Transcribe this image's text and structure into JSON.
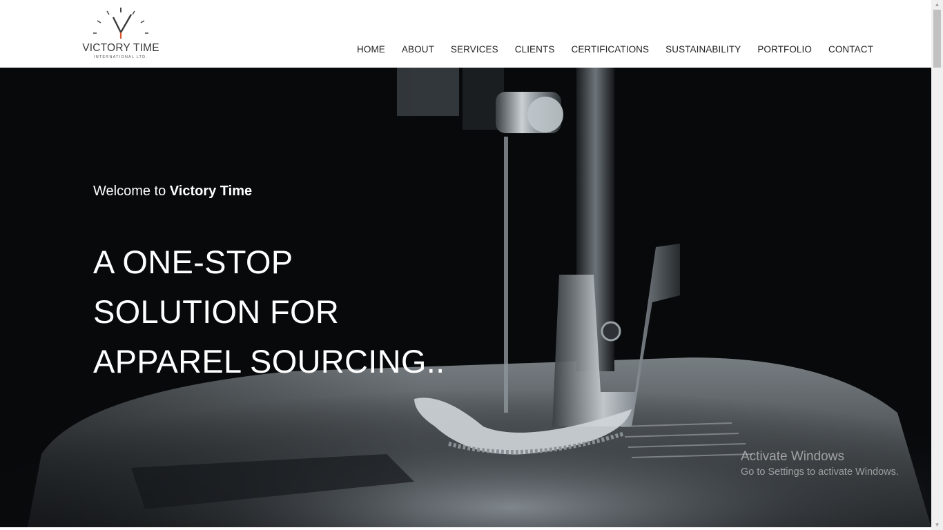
{
  "brand": {
    "name": "VICTORY TIME",
    "subtitle": "INTERNATIONAL LTD."
  },
  "nav": {
    "items": [
      {
        "label": "HOME"
      },
      {
        "label": "ABOUT"
      },
      {
        "label": "SERVICES"
      },
      {
        "label": "CLIENTS"
      },
      {
        "label": "CERTIFICATIONS"
      },
      {
        "label": "SUSTAINABILITY"
      },
      {
        "label": "PORTFOLIO"
      },
      {
        "label": "CONTACT"
      }
    ]
  },
  "hero": {
    "welcome_prefix": "Welcome to ",
    "welcome_brand": "Victory Time",
    "headline_lines": [
      "A ONE-STOP",
      "SOLUTION FOR",
      "APPAREL SOURCING.."
    ],
    "background_icon": "sewing-machine-image"
  },
  "watermark": {
    "title": "Activate Windows",
    "subtitle": "Go to Settings to activate Windows."
  },
  "colors": {
    "header_bg": "#ffffff",
    "hero_bg": "#07090b",
    "text_light": "#ffffff",
    "logo_accent": "#d9532c"
  }
}
